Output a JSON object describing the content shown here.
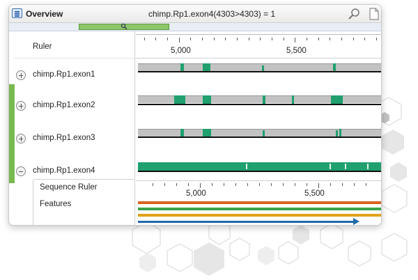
{
  "window": {
    "title": "Overview",
    "center_text": "chimp.Rp1.exon4(4303>4303) = 1",
    "icons": [
      "overview-icon",
      "zoom-icon",
      "export-page-icon"
    ]
  },
  "ruler": {
    "label": "Ruler",
    "ticks": [
      "5,000",
      "5,500"
    ]
  },
  "tracks": [
    {
      "label": "chimp.Rp1.exon1",
      "state": "collapsed"
    },
    {
      "label": "chimp.Rp1.exon2",
      "state": "collapsed"
    },
    {
      "label": "chimp.Rp1.exon3",
      "state": "collapsed"
    },
    {
      "label": "chimp.Rp1.exon4",
      "state": "expanded"
    }
  ],
  "sub_tracks": {
    "sequence_ruler_label": "Sequence Ruler",
    "features_label": "Features",
    "ticks": [
      "5,000",
      "5,500"
    ]
  },
  "colors": {
    "exon_green": "#1fa06e",
    "feature_orange": "#d9621f",
    "feature_green": "#3aa34a",
    "feature_gold": "#e0a21a",
    "feature_blue": "#1f6aa8"
  }
}
